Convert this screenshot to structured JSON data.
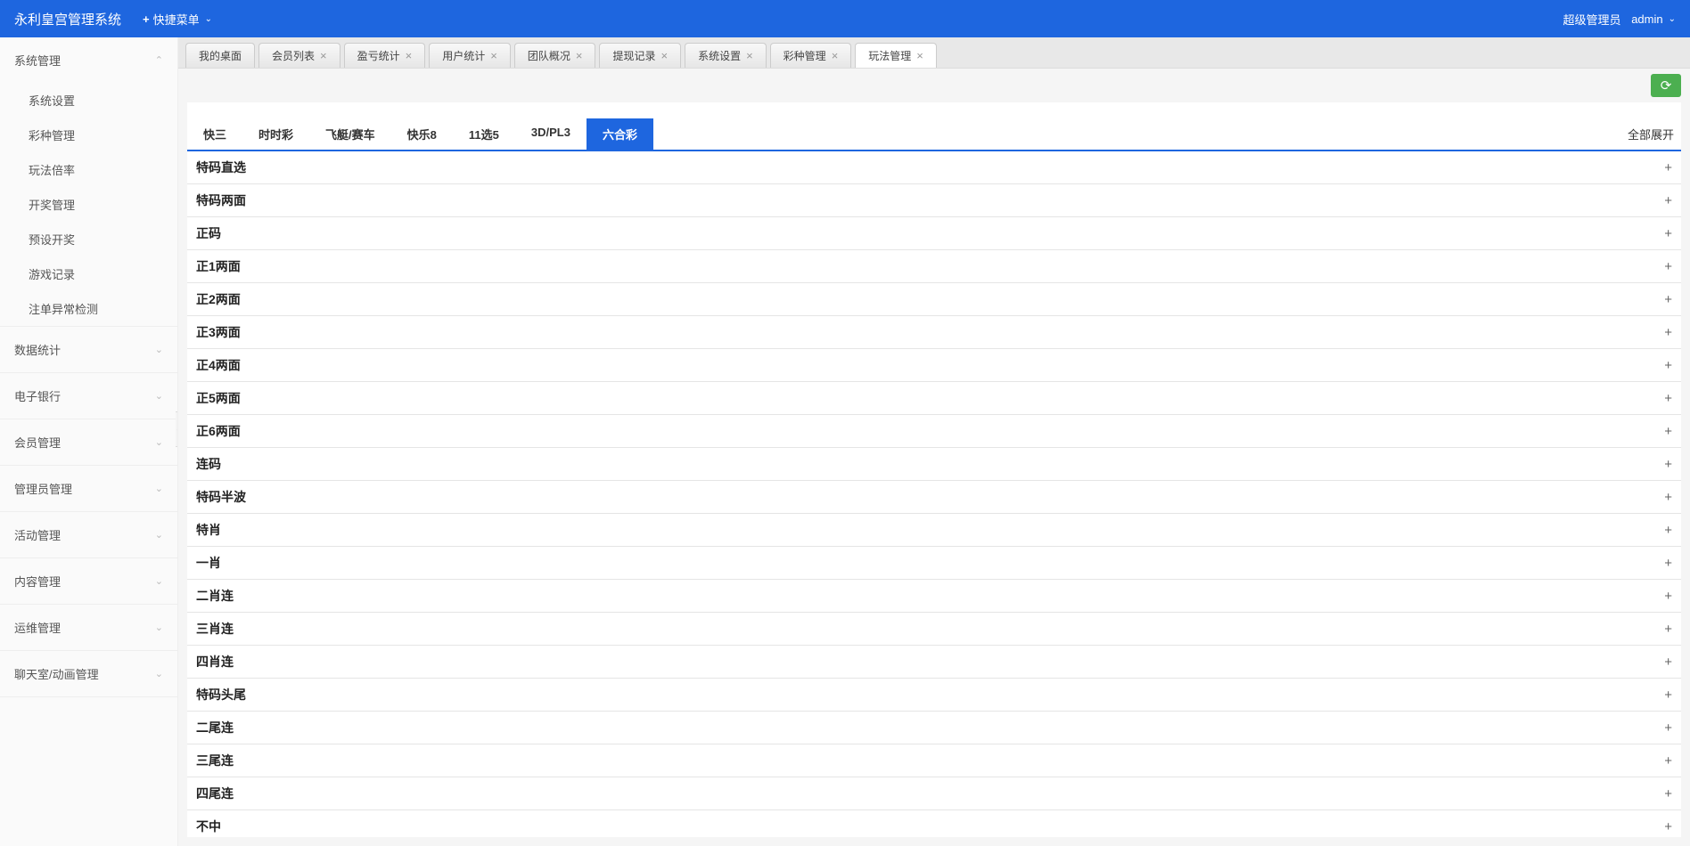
{
  "header": {
    "app_title": "永利皇宫管理系统",
    "quick_menu": "快捷菜单",
    "user_role": "超级管理员",
    "user_name": "admin"
  },
  "sidebar": {
    "groups": [
      {
        "label": "系统管理",
        "expanded": true,
        "items": [
          "系统设置",
          "彩种管理",
          "玩法倍率",
          "开奖管理",
          "预设开奖",
          "游戏记录",
          "注单异常检测"
        ]
      },
      {
        "label": "数据统计",
        "expanded": false
      },
      {
        "label": "电子银行",
        "expanded": false
      },
      {
        "label": "会员管理",
        "expanded": false
      },
      {
        "label": "管理员管理",
        "expanded": false
      },
      {
        "label": "活动管理",
        "expanded": false
      },
      {
        "label": "内容管理",
        "expanded": false
      },
      {
        "label": "运维管理",
        "expanded": false
      },
      {
        "label": "聊天室/动画管理",
        "expanded": false
      }
    ]
  },
  "tabs": [
    {
      "label": "我的桌面",
      "closable": false,
      "active": false
    },
    {
      "label": "会员列表",
      "closable": true,
      "active": false
    },
    {
      "label": "盈亏统计",
      "closable": true,
      "active": false
    },
    {
      "label": "用户统计",
      "closable": true,
      "active": false
    },
    {
      "label": "团队概况",
      "closable": true,
      "active": false
    },
    {
      "label": "提现记录",
      "closable": true,
      "active": false
    },
    {
      "label": "系统设置",
      "closable": true,
      "active": false
    },
    {
      "label": "彩种管理",
      "closable": true,
      "active": false
    },
    {
      "label": "玩法管理",
      "closable": true,
      "active": true
    }
  ],
  "content": {
    "cat_tabs": [
      "快三",
      "时时彩",
      "飞艇/赛车",
      "快乐8",
      "11选5",
      "3D/PL3",
      "六合彩"
    ],
    "cat_active": 6,
    "expand_all_label": "全部展开",
    "rows": [
      "特码直选",
      "特码两面",
      "正码",
      "正1两面",
      "正2两面",
      "正3两面",
      "正4两面",
      "正5两面",
      "正6两面",
      "连码",
      "特码半波",
      "特肖",
      "一肖",
      "二肖连",
      "三肖连",
      "四肖连",
      "特码头尾",
      "二尾连",
      "三尾连",
      "四尾连",
      "不中"
    ]
  }
}
